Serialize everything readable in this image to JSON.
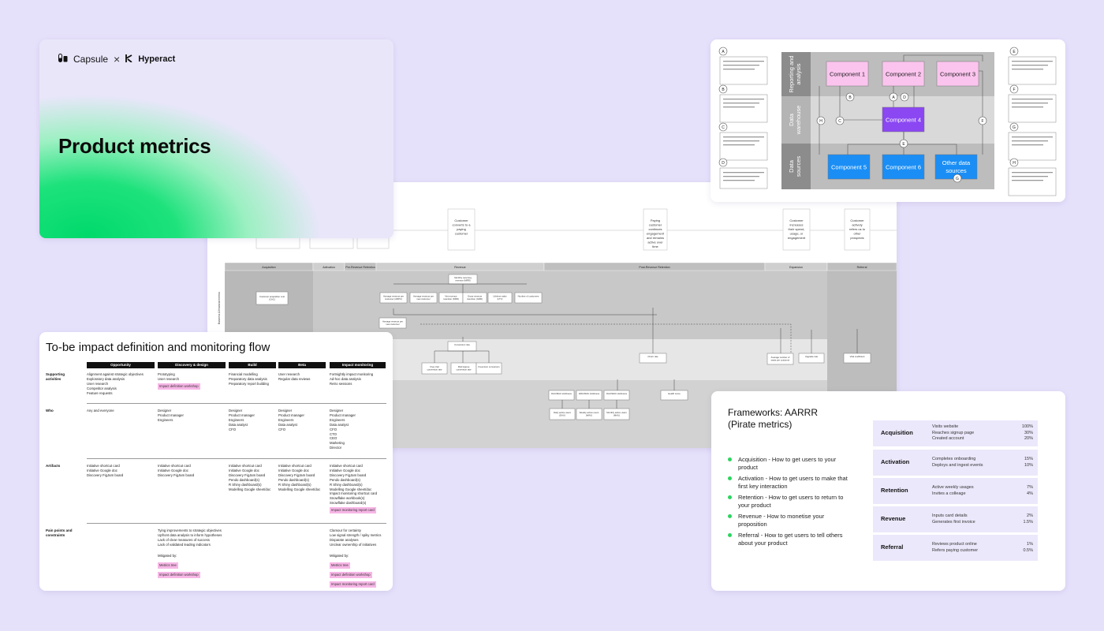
{
  "title_card": {
    "brand_left": "Capsule",
    "brand_sep": "×",
    "brand_right": "Hyperact",
    "title": "Product metrics"
  },
  "process_map": {
    "top_nodes": [
      "Customer converts to a paying customer",
      "Paying customer continues engagement and remains active over time",
      "Customer increases their spend, usage, or engagement",
      "Customer actively refers us to other prospects"
    ],
    "phases": [
      "Acquisition",
      "Activation",
      "Pre-Revenue Retention",
      "Revenue",
      "Post-Revenue Retention",
      "Expansion",
      "Referral"
    ],
    "row_labels": [
      "Business & financial metrics"
    ],
    "nodes": {
      "cac": "Customer acquisition cost (CAC)",
      "mrr": "Monthly recurring revenue (MRR)",
      "arpc": "Average revenue per customer (ARPC)",
      "net_rev_retention": "Net revenue retention (NRR)",
      "gross_rev_retention": "Gross revenue retention (GRR)",
      "ltv": "Lifetime value (LTV)",
      "num_customers": "Number of customers",
      "arpu": "Average revenue per new customer",
      "churn": "Churn rate",
      "avg_seats": "Average number of seats per customer",
      "upgrade": "Upgrade rate",
      "viral": "Viral coefficient",
      "conversion": "Conversion rate",
      "trial_conv": "Free trial conversion rate",
      "paid_conv": "Paid signup conversion rate",
      "freemium_conv": "Freemium conversion",
      "health": "Health score",
      "dau_mau": "DAU/MAU stickiness",
      "wau_mau": "WAU/MAU stickiness",
      "dau_wau": "DAU/WAU stickiness",
      "dau": "Daily active users (DAU)",
      "wau": "Weekly active users (WAU)",
      "mau": "Monthly active users (MAU)"
    }
  },
  "arch_card": {
    "bands": [
      "Reporting and analysis",
      "Data warehouse",
      "Data sources"
    ],
    "components": [
      "Component 1",
      "Component 2",
      "Component 3",
      "Component 4",
      "Component 5",
      "Component 6",
      "Other data sources"
    ],
    "letters": [
      "A",
      "B",
      "C",
      "D",
      "E",
      "F",
      "G",
      "H"
    ],
    "colors": {
      "pink": "#fbc4ee",
      "purple": "#8a47f2",
      "blue": "#1a8ef5",
      "band_dark": "#8c8c8c",
      "band_light": "#d9d9d9"
    }
  },
  "impact_card": {
    "title": "To-be impact definition and monitoring flow",
    "columns": [
      "Opportunity",
      "Discovery & design",
      "Build",
      "Beta",
      "Impact monitoring"
    ],
    "rows": [
      {
        "label": "Supporting activities",
        "cells": [
          "Alignment against strategic objectives\nExploratory data analysis\nUser research\nCompetitor analysis\nFeature requests",
          "Prototyping\nUser research",
          "Financial modelling\nPreparatory data analysis\nPreparatory report building",
          "User research\nRegular data reviews",
          "Fortnightly impact monitoring\nAd-hoc data analysis\nRetro sessions"
        ],
        "tags": {
          "1": [
            "Impact definition workshop"
          ]
        }
      },
      {
        "label": "Who",
        "cells": [
          "Any and everyone",
          "Designer\nProduct manager\nEngineers",
          "Designer\nProduct manager\nEngineers\nData analyst\nCFO",
          "Designer\nProduct manager\nEngineers\nData analyst\nCFO",
          "Designer\nProduct manager\nEngineers\nData analyst\nCFO\nCTO\nCEO\nMarketing\nDirector"
        ]
      },
      {
        "label": "Artifacts",
        "cells": [
          "Initiative shortcut card\nInitiative Google doc\nDiscovery FigJam board",
          "Initiative shortcut card\nInitiative Google doc\nDiscovery FigJam board",
          "Initiative shortcut card\nInitiative Google doc\nDiscovery FigJam board\nPendo dashboard(s)\nR Shiny dashboard(s)\nModelling Google sheet/doc",
          "Initiative shortcut card\nInitiative Google doc\nDiscovery FigJam board\nPendo dashboard(s)\nR Shiny dashboard(s)\nModelling Google sheet/doc",
          "Initiative shortcut card\nInitiative Google doc\nDiscovery FigJam board\nPendo dashboard(s)\nR Shiny dashboard(s)\nModelling Google sheet/doc\nImpact monitoring shortcut card\nSnowflake workbook(s)\nSnowflake dashboard(s)"
        ],
        "tags": {
          "4": [
            "Impact monitoring report card"
          ]
        }
      },
      {
        "label": "Pain points and constraints",
        "cells": [
          "",
          "Tying improvements to strategic objectives\nUpfront data analysis to inform hypotheses\nLack of clear measures of success\nLack of validated leading indicators",
          "",
          "",
          "Clamour for certainty\nLow signal strength / spiky metrics\nDisparate analyses\nUnclear ownership of initiatives"
        ],
        "mitigated_label": "Mitigated by:",
        "tags": {
          "1": [
            "Metrics tree",
            "Impact definition workshop"
          ],
          "4": [
            "Metrics tree",
            "Impact definition workshop",
            "Impact monitoring report card"
          ]
        }
      }
    ]
  },
  "aarrr_card": {
    "title_line1": "Frameworks: AARRR",
    "title_line2": "(Pirate metrics)",
    "bullets": [
      "Acquisition - How to get users to your product",
      "Activation - How to get users to make that first key interaction",
      "Retention - How to get users to return to your product",
      "Revenue - How to monetise your proposition",
      "Referral - How to get users to tell others about your product"
    ],
    "stages": [
      {
        "name": "Acquisition",
        "metrics": [
          {
            "label": "Visits website",
            "value": "100%"
          },
          {
            "label": "Reaches signup page",
            "value": "30%"
          },
          {
            "label": "Created account",
            "value": "20%"
          }
        ]
      },
      {
        "name": "Activation",
        "metrics": [
          {
            "label": "Completes onboarding",
            "value": "15%"
          },
          {
            "label": "Deploys and ingest events",
            "value": "10%"
          }
        ]
      },
      {
        "name": "Retention",
        "metrics": [
          {
            "label": "Active weekly usages",
            "value": "7%"
          },
          {
            "label": "Invites a colleage",
            "value": "4%"
          }
        ]
      },
      {
        "name": "Revenue",
        "metrics": [
          {
            "label": "Inputs card details",
            "value": "2%"
          },
          {
            "label": "Generates first invoice",
            "value": "1.5%"
          }
        ]
      },
      {
        "name": "Referral",
        "metrics": [
          {
            "label": "Reviews product online",
            "value": "1%"
          },
          {
            "label": "Refers paying customer",
            "value": "0.5%"
          }
        ]
      }
    ],
    "bullet_color": "#2dd45f",
    "stage_bg": "#ece8fb"
  }
}
